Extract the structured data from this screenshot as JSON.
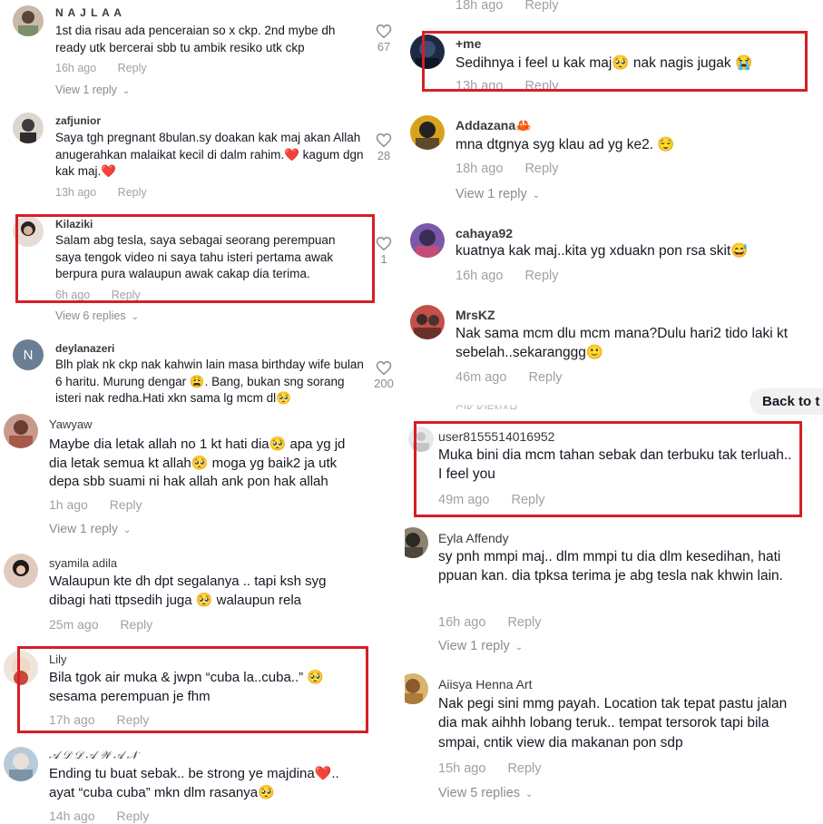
{
  "left_comments": [
    {
      "username": "N A J L A A",
      "text": "1st dia risau ada penceraian so x ckp. 2nd mybe dh ready utk bercerai sbb tu ambik resiko utk ckp",
      "time": "16h ago",
      "reply": "Reply",
      "view_replies": "View 1 reply",
      "likes": "67"
    },
    {
      "username": "zafjunior",
      "text": "Saya tgh pregnant 8bulan.sy doakan kak maj akan Allah anugerahkan malaikat kecil di dalm rahim.❤️ kagum dgn kak maj.❤️",
      "time": "13h ago",
      "reply": "Reply",
      "likes": "28"
    },
    {
      "username": "Kilaziki",
      "text": "Salam abg tesla, saya sebagai seorang perempuan saya tengok video ni saya tahu isteri pertama awak berpura pura walaupun awak cakap dia terima.",
      "time": "6h ago",
      "reply": "Reply",
      "view_replies": "View 6 replies",
      "likes": "1"
    },
    {
      "username": "deylanazeri",
      "avatar_letter": "N",
      "text": "Blh plak nk ckp nak kahwin lain masa birthday wife bulan 6 haritu. Murung dengar 😩. Bang, bukan sng sorang isteri nak redha.Hati xkn sama lg mcm dl🥺",
      "likes": "200"
    },
    {
      "username": "Yawyaw",
      "text": "Maybe dia letak allah no 1 kt hati dia🥺 apa yg jd dia letak semua kt allah🥺 moga yg baik2 ja utk depa sbb suami ni hak allah ank pon hak allah",
      "time": "1h ago",
      "reply": "Reply",
      "view_replies": "View 1 reply"
    },
    {
      "username": "syamila adila",
      "text": "Walaupun kte dh dpt segalanya .. tapi ksh syg dibagi hati ttpsedih juga 🥺 walaupun rela",
      "time": "25m ago",
      "reply": "Reply"
    },
    {
      "username": "Lily",
      "text": "Bila tgok air muka & jwpn “cuba la..cuba..” 🥺 sesama perempuan je fhm",
      "time": "17h ago",
      "reply": "Reply"
    },
    {
      "username": "𝒜 𝒟 𝒟 𝒜 𝒲 𝒜 𝒩",
      "text": "Ending tu buat sebak.. be strong ye majdina❤️.. ayat “cuba cuba” mkn dlm rasanya🥺",
      "time": "14h ago",
      "reply": "Reply"
    }
  ],
  "right_comments": [
    {
      "time": "18h ago",
      "reply": "Reply"
    },
    {
      "username": "+me",
      "text": "Sedihnya i feel u kak maj🥺 nak nagis jugak 😭",
      "time": "13h ago",
      "reply": "Reply"
    },
    {
      "username": "Addazana🦀",
      "text": "mna dtgnya syg klau ad yg ke2. 😌",
      "time": "18h ago",
      "reply": "Reply",
      "view_replies": "View 1 reply"
    },
    {
      "username": "cahaya92",
      "text": "kuatnya kak maj..kita yg xduakn pon rsa skit😅",
      "time": "16h ago",
      "reply": "Reply"
    },
    {
      "username": "MrsKZ",
      "text": "Nak sama mcm dlu mcm mana?Dulu hari2 tido laki kt sebelah..sekaranggg🙂",
      "time": "46m ago",
      "reply": "Reply"
    },
    {
      "username": "user8155514016952",
      "text": "Muka bini dia mcm tahan sebak dan terbuku tak terluah.. I feel you",
      "time": "49m ago",
      "reply": "Reply"
    },
    {
      "username": "Eyla Affendy",
      "text": "sy pnh mmpi maj.. dlm mmpi tu dia dlm kesedihan, hati ppuan kan. dia tpksa terima je abg tesla nak khwin lain.",
      "time": "16h ago",
      "reply": "Reply",
      "view_replies": "View 1 reply"
    },
    {
      "username": "Aiisya Henna Art",
      "text": "Nak pegi sini mmg payah. Location tak tepat pastu jalan dia mak aihhh lobang teruk.. tempat tersorok tapi bila smpai, cntik view dia makanan pon sdp",
      "time": "15h ago",
      "reply": "Reply",
      "view_replies": "View 5 replies"
    }
  ],
  "overlay": {
    "back_label": "Back to t",
    "partial_name": "CIK KIENAH"
  },
  "colors": {
    "highlight": "#d61f26",
    "meta": "#a0a0a8",
    "text": "#161823"
  }
}
